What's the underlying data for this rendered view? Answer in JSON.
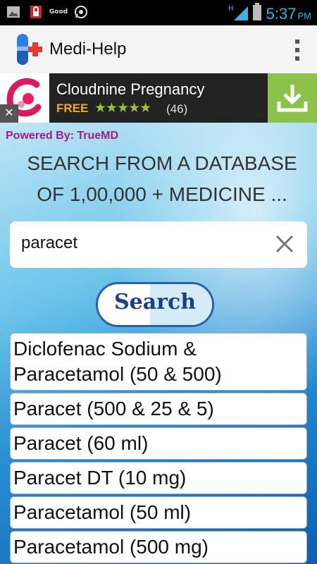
{
  "status_bar": {
    "time": "5:37",
    "ampm": "PM",
    "notification": "Good"
  },
  "app": {
    "title": "Medi-Help"
  },
  "ad": {
    "title": "Cloudnine Pregnancy",
    "price": "FREE",
    "stars": "★★★★★",
    "rating_count": "(46)",
    "close": "✕"
  },
  "content": {
    "powered_by": "Powered By: TrueMD",
    "headline": "SEARCH FROM A DATABASE OF 1,00,000 + MEDICINE ...",
    "search": {
      "value": "paracet",
      "button_label": "Search"
    },
    "results": [
      "Diclofenac Sodium & Paracetamol (50 & 500)",
      "Paracet (500 & 25 & 5)",
      "Paracet (60 ml)",
      "Paracet DT (10 mg)",
      "Paracetamol (50 ml)",
      "Paracetamol (500 mg)"
    ]
  }
}
